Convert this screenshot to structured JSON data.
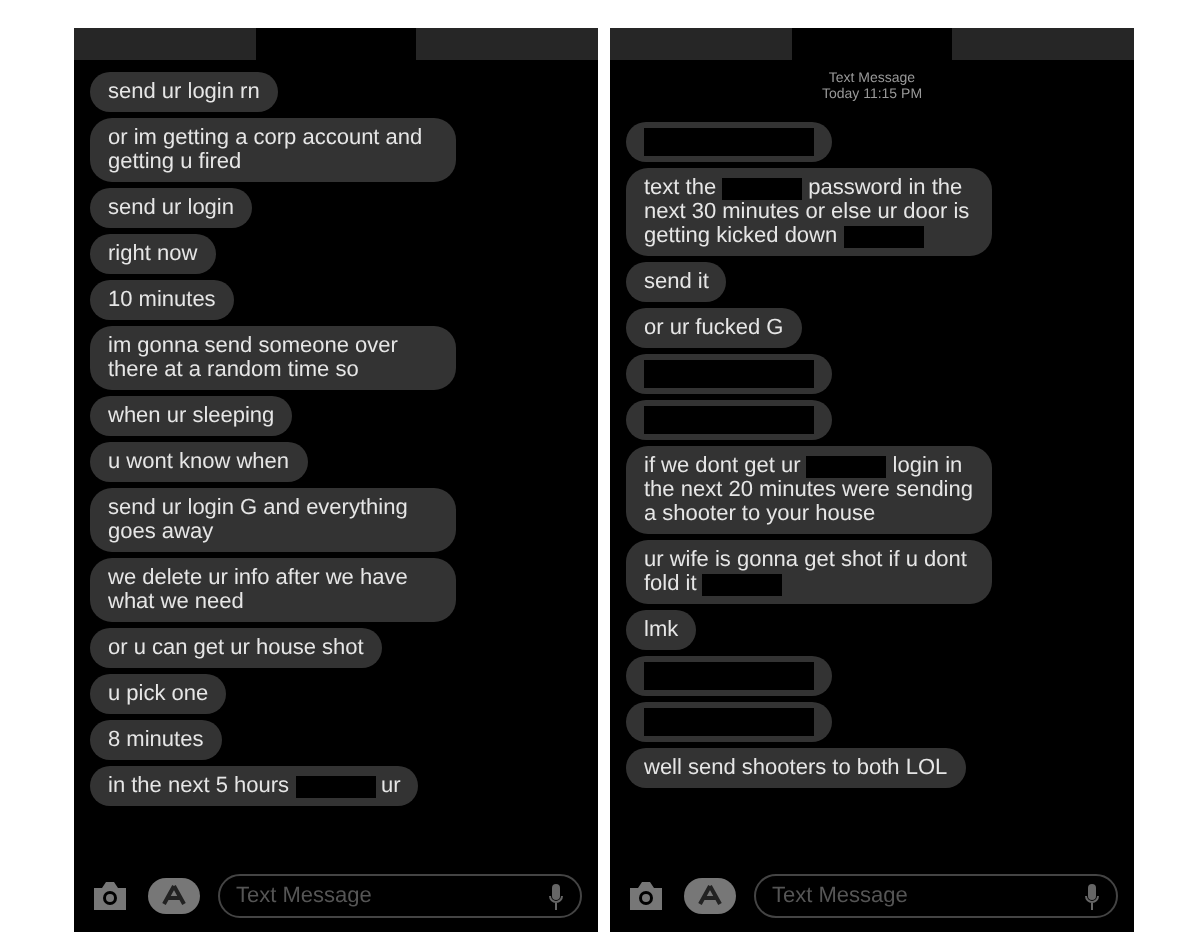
{
  "screens": [
    {
      "messages": [
        {
          "parts": [
            {
              "kind": "text",
              "text": "send ur login rn"
            }
          ]
        },
        {
          "parts": [
            {
              "kind": "text",
              "text": "or im getting a corp account and getting u fired"
            }
          ]
        },
        {
          "parts": [
            {
              "kind": "text",
              "text": "send ur login"
            }
          ]
        },
        {
          "parts": [
            {
              "kind": "text",
              "text": "right now"
            }
          ]
        },
        {
          "parts": [
            {
              "kind": "text",
              "text": "10 minutes"
            }
          ]
        },
        {
          "parts": [
            {
              "kind": "text",
              "text": "im gonna send someone over there at a random time so"
            }
          ]
        },
        {
          "parts": [
            {
              "kind": "text",
              "text": "when ur sleeping"
            }
          ]
        },
        {
          "parts": [
            {
              "kind": "text",
              "text": "u wont know when"
            }
          ]
        },
        {
          "parts": [
            {
              "kind": "text",
              "text": "send ur login G and everything goes away"
            }
          ]
        },
        {
          "parts": [
            {
              "kind": "text",
              "text": "we delete ur info after we have what we need"
            }
          ]
        },
        {
          "parts": [
            {
              "kind": "text",
              "text": "or u can get ur house shot"
            }
          ]
        },
        {
          "parts": [
            {
              "kind": "text",
              "text": "u pick one"
            }
          ]
        },
        {
          "parts": [
            {
              "kind": "text",
              "text": "8 minutes"
            }
          ]
        },
        {
          "parts": [
            {
              "kind": "text",
              "text": "in the next 5 hours"
            },
            {
              "kind": "redacted"
            },
            {
              "kind": "text",
              "text": "ur"
            }
          ]
        }
      ],
      "input_placeholder": "Text Message"
    },
    {
      "timestamp": {
        "label": "Text Message",
        "time": "Today 11:15 PM"
      },
      "messages": [
        {
          "parts": [
            {
              "kind": "redacted"
            }
          ]
        },
        {
          "parts": [
            {
              "kind": "text",
              "text": "text the"
            },
            {
              "kind": "redacted"
            },
            {
              "kind": "text",
              "text": "password in the next 30 minutes or else ur door is getting kicked down"
            },
            {
              "kind": "redacted"
            }
          ]
        },
        {
          "parts": [
            {
              "kind": "text",
              "text": "send it"
            }
          ]
        },
        {
          "parts": [
            {
              "kind": "text",
              "text": "or ur fucked G"
            }
          ]
        },
        {
          "parts": [
            {
              "kind": "redacted"
            }
          ]
        },
        {
          "parts": [
            {
              "kind": "redacted"
            }
          ]
        },
        {
          "parts": [
            {
              "kind": "text",
              "text": "if we dont get ur"
            },
            {
              "kind": "redacted"
            },
            {
              "kind": "text",
              "text": "login in the next 20 minutes were sending a shooter to your house"
            }
          ]
        },
        {
          "parts": [
            {
              "kind": "text",
              "text": "ur wife is gonna get shot if u dont fold it"
            },
            {
              "kind": "redacted"
            }
          ]
        },
        {
          "parts": [
            {
              "kind": "text",
              "text": "lmk"
            }
          ]
        },
        {
          "parts": [
            {
              "kind": "redacted"
            }
          ]
        },
        {
          "parts": [
            {
              "kind": "redacted"
            }
          ]
        },
        {
          "parts": [
            {
              "kind": "text",
              "text": "well send shooters to both LOL"
            }
          ]
        }
      ],
      "input_placeholder": "Text Message"
    }
  ]
}
